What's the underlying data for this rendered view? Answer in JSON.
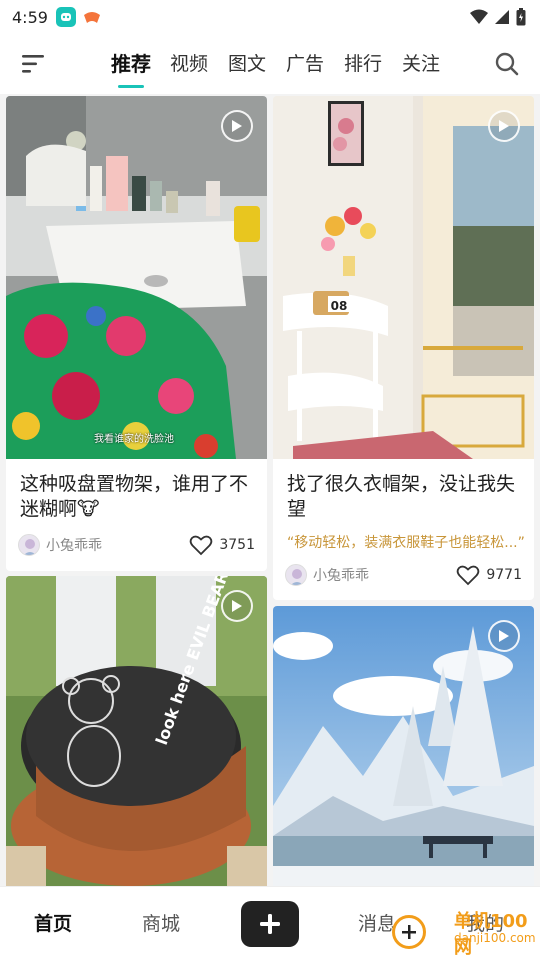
{
  "status": {
    "time": "4:59"
  },
  "nav": {
    "tabs": [
      {
        "label": "推荐",
        "active": true
      },
      {
        "label": "视频"
      },
      {
        "label": "图文"
      },
      {
        "label": "广告"
      },
      {
        "label": "排行"
      },
      {
        "label": "关注"
      }
    ]
  },
  "feed": {
    "cards": [
      {
        "title": "这种吸盘置物架，谁用了不迷糊啊🐮",
        "author": "小兔乖乖",
        "likes": "3751",
        "caption": "我看谁家的洗脸池",
        "is_video": true
      },
      {
        "title": "找了很久衣帽架，没让我失望",
        "subtitle": "“移动轻松，装满衣服鞋子也能轻松...”",
        "author": "小兔乖乖",
        "likes": "9771",
        "is_video": true
      },
      {
        "is_video": true,
        "print_text": "look here EVIL BEAR"
      },
      {
        "is_video": true
      },
      {
        "clock_number": "08"
      }
    ]
  },
  "bottom_nav": {
    "home": "首页",
    "mall": "商城",
    "messages": "消息",
    "mine": "我的"
  },
  "watermark": {
    "name": "单机100网",
    "url": "danji100.com"
  },
  "colors": {
    "accent": "#19c3b8",
    "subtitle": "#c8963a",
    "watermark": "#f29d1a"
  }
}
